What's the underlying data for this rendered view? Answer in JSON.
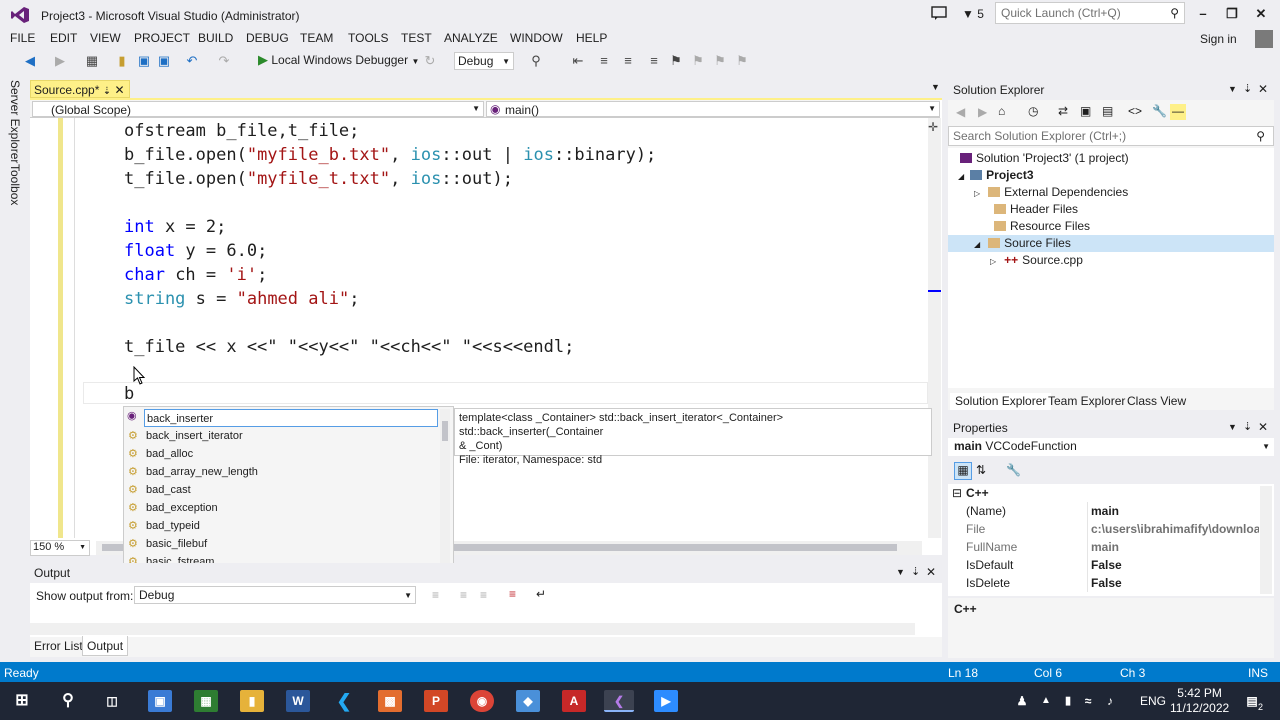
{
  "window": {
    "title": "Project3 - Microsoft Visual Studio (Administrator)",
    "notification_count": "5",
    "quick_launch_placeholder": "Quick Launch (Ctrl+Q)"
  },
  "menu": [
    "FILE",
    "EDIT",
    "VIEW",
    "PROJECT",
    "BUILD",
    "DEBUG",
    "TEAM",
    "TOOLS",
    "TEST",
    "ANALYZE",
    "WINDOW",
    "HELP"
  ],
  "signin": "Sign in",
  "toolbar": {
    "debugger_label": "Local Windows Debugger",
    "configuration": "Debug"
  },
  "side_rail": [
    "Server Explorer",
    "Toolbox"
  ],
  "editor": {
    "tab_label": "Source.cpp*",
    "scope_left": "(Global Scope)",
    "scope_right": "main()",
    "zoom": "150 %",
    "code_lines": [
      "ofstream b_file,t_file;",
      "b_file.open(\"myfile_b.txt\", ios::out | ios::binary);",
      "t_file.open(\"myfile_t.txt\", ios::out);",
      "",
      "int x = 2;",
      "float y = 6.0;",
      "char ch = 'i';",
      "string s = \"ahmed ali\";",
      "",
      "t_file << x <<\" \"<<y<<\" \"<<ch<<\" \"<<s<<endl;",
      "",
      "b"
    ]
  },
  "intellisense": {
    "items": [
      "back_inserter",
      "back_insert_iterator",
      "bad_alloc",
      "bad_array_new_length",
      "bad_cast",
      "bad_exception",
      "bad_typeid",
      "basic_filebuf",
      "basic_fstream"
    ],
    "selected_index": 0,
    "tooltip_line1": "template<class _Container> std::back_insert_iterator<_Container> std::back_inserter(_Container",
    "tooltip_line2": "& _Cont)",
    "tooltip_line3": "File: iterator, Namespace: std"
  },
  "output": {
    "title": "Output",
    "show_label": "Show output from:",
    "source": "Debug",
    "tabs": [
      "Error List",
      "Output"
    ]
  },
  "solution_explorer": {
    "title": "Solution Explorer",
    "search_placeholder": "Search Solution Explorer (Ctrl+;)",
    "tree": [
      "Solution 'Project3' (1 project)",
      "Project3",
      "External Dependencies",
      "Header Files",
      "Resource Files",
      "Source Files",
      "Source.cpp"
    ],
    "tabs": [
      "Solution Explorer",
      "Team Explorer",
      "Class View"
    ]
  },
  "properties": {
    "title": "Properties",
    "object_name": "main",
    "object_type": "VCCodeFunction",
    "category": "C++",
    "rows": [
      {
        "k": "(Name)",
        "v": "main"
      },
      {
        "k": "File",
        "v": "c:\\users\\ibrahimafify\\download:"
      },
      {
        "k": "FullName",
        "v": "main"
      },
      {
        "k": "IsDefault",
        "v": "False"
      },
      {
        "k": "IsDelete",
        "v": "False"
      }
    ],
    "description": "C++"
  },
  "status": {
    "ready": "Ready",
    "line": "Ln 18",
    "col": "Col 6",
    "ch": "Ch 3",
    "mode": "INS"
  },
  "taskbar": {
    "lang": "ENG",
    "time": "5:42 PM",
    "date": "11/12/2022",
    "notifications": "2"
  },
  "colors": {
    "accent": "#007acc",
    "editor_tab": "#fef088",
    "keyword": "#0000ff",
    "type": "#2b91af",
    "string": "#a31515"
  }
}
